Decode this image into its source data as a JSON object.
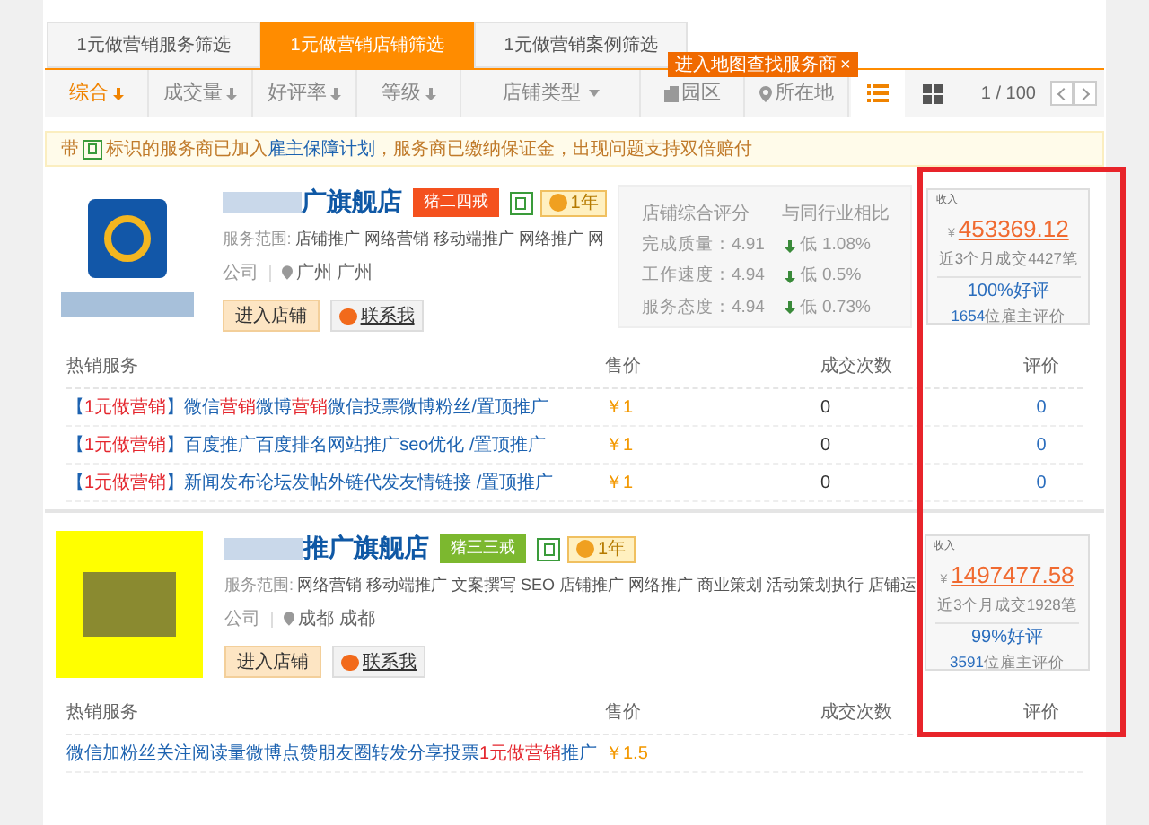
{
  "tabs": [
    {
      "label": "1元做营销服务筛选",
      "selected": false
    },
    {
      "label": "1元做营销店铺筛选",
      "selected": true
    },
    {
      "label": "1元做营销案例筛选",
      "selected": false
    }
  ],
  "map_tip": {
    "label": "进入地图查找服务商",
    "close": "×"
  },
  "filters": [
    {
      "label": "综合",
      "kind": "sort",
      "selected": true
    },
    {
      "label": "成交量",
      "kind": "sort",
      "selected": false
    },
    {
      "label": "好评率",
      "kind": "sort",
      "selected": false
    },
    {
      "label": "等级",
      "kind": "sort",
      "selected": false
    },
    {
      "label": "店铺类型",
      "kind": "dropdown",
      "selected": false
    },
    {
      "label": "园区",
      "kind": "park",
      "selected": false
    },
    {
      "label": "所在地",
      "kind": "location",
      "selected": false
    }
  ],
  "view_modes": [
    {
      "kind": "list",
      "selected": true
    },
    {
      "kind": "grid",
      "selected": false
    }
  ],
  "pager": "1 / 100",
  "notice": {
    "before": "带",
    "after": "标识的服务商已加入",
    "link": "雇主保障计划",
    "rest": "，服务商已缴纳保证金，出现问题支持双倍赔付"
  },
  "stores": [
    {
      "kind": "blue_logo",
      "name": "广旗舰店",
      "level": "猪二四戒",
      "color": "#f4511e",
      "years": "1年",
      "scope_label": "服务范围:",
      "scope": "店铺推广 网络营销 移动端推广 网络推广 网",
      "type": "公司",
      "location": "广州 广州",
      "enter": "进入店铺",
      "contact": "联系我",
      "scores": {
        "title": "店铺综合评分",
        "compare_title": "与同行业相比",
        "rows": [
          {
            "label": "完成质量：4.91",
            "compare": "低 1.08%"
          },
          {
            "label": "工作速度：4.94",
            "compare": "低 0.5%"
          },
          {
            "label": "服务态度：4.94",
            "compare": "低 0.73%"
          }
        ]
      },
      "income": {
        "tag": "收入",
        "currency": "¥",
        "amount": "453369.12",
        "deals": "近3个月成交4427笔",
        "rate": "100%好评",
        "reviews_count": "1654",
        "reviews_label": "位雇主评价"
      },
      "services": {
        "columns": [
          "热销服务",
          "售价",
          "成交次数",
          "评价"
        ],
        "rows": [
          {
            "parts": [
              {
                "text": "【",
                "kind": "plain"
              },
              {
                "text": "1元做营销",
                "kind": "hot"
              },
              {
                "text": "】微信",
                "kind": "plain"
              },
              {
                "text": "营销",
                "kind": "hot"
              },
              {
                "text": "微博",
                "kind": "plain"
              },
              {
                "text": "营销",
                "kind": "hot"
              },
              {
                "text": "微信投票微博粉丝/置顶推广",
                "kind": "plain"
              }
            ],
            "price": "￥1",
            "deals": "0",
            "reviews": "0"
          },
          {
            "parts": [
              {
                "text": "【",
                "kind": "plain"
              },
              {
                "text": "1元做营销",
                "kind": "hot"
              },
              {
                "text": "】百度推广百度排名网站推广seo优化 /置顶推广",
                "kind": "plain"
              }
            ],
            "price": "￥1",
            "deals": "0",
            "reviews": "0"
          },
          {
            "parts": [
              {
                "text": "【",
                "kind": "plain"
              },
              {
                "text": "1元做营销",
                "kind": "hot"
              },
              {
                "text": "】新闻发布论坛发帖外链代发友情链接 /置顶推广",
                "kind": "plain"
              }
            ],
            "price": "￥1",
            "deals": "0",
            "reviews": "0"
          }
        ]
      }
    },
    {
      "kind": "yellow_logo",
      "name": "推广旗舰店",
      "level": "猪三三戒",
      "color": "#7cb82f",
      "years": "1年",
      "scope_label": "服务范围:",
      "scope": "网络营销 移动端推广 文案撰写 SEO 店铺推广 网络推广 商业策划 活动策划执行 店铺运",
      "type": "公司",
      "location": "成都 成都",
      "enter": "进入店铺",
      "contact": "联系我",
      "income": {
        "tag": "收入",
        "currency": "¥",
        "amount": "1497477.58",
        "deals": "近3个月成交1928笔",
        "rate": "99%好评",
        "reviews_count": "3591",
        "reviews_label": "位雇主评价"
      },
      "services": {
        "columns": [
          "热销服务",
          "售价",
          "成交次数",
          "评价"
        ],
        "rows": [
          {
            "parts": [
              {
                "text": "微信加粉丝关注阅读量微博点赞朋友圈转发分享投票",
                "kind": "plain"
              },
              {
                "text": "1元做营销",
                "kind": "hot"
              },
              {
                "text": "推广",
                "kind": "plain"
              }
            ],
            "price": "￥1.5"
          }
        ]
      }
    }
  ]
}
